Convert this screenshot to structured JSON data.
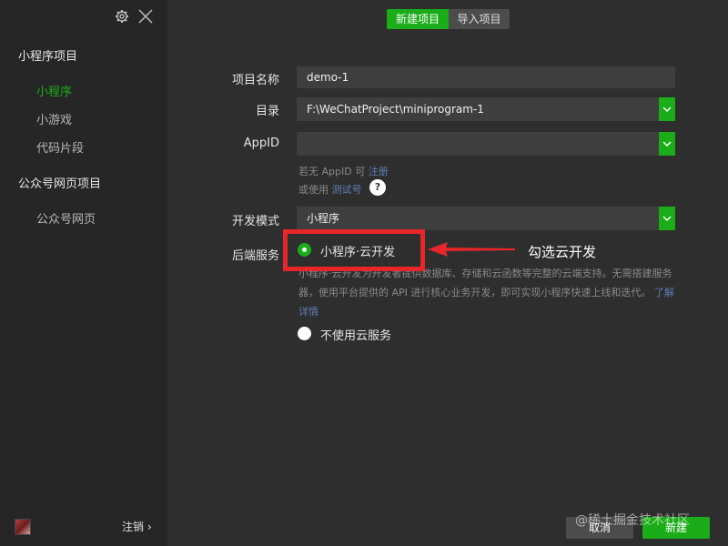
{
  "sidebar": {
    "groups": [
      {
        "title": "小程序项目",
        "items": [
          {
            "label": "小程序",
            "active": true
          },
          {
            "label": "小游戏",
            "active": false
          },
          {
            "label": "代码片段",
            "active": false
          }
        ]
      },
      {
        "title": "公众号网页项目",
        "items": [
          {
            "label": "公众号网页",
            "active": false
          }
        ]
      }
    ],
    "logout": "注销",
    "logout_chevron": "›"
  },
  "tabs": {
    "new": "新建项目",
    "import": "导入项目"
  },
  "form": {
    "name_label": "项目名称",
    "name_value": "demo-1",
    "dir_label": "目录",
    "dir_value": "F:\\WeChatProject\\miniprogram-1",
    "appid_label": "AppID",
    "appid_value": "",
    "appid_hint_prefix": "若无 AppID 可",
    "appid_hint_link": "注册",
    "test_hint_prefix": "或使用",
    "test_hint_link": "测试号",
    "help_glyph": "?",
    "mode_label": "开发模式",
    "mode_value": "小程序",
    "backend_label": "后端服务",
    "option_cloud": "小程序·云开发",
    "option_cloud_desc": "小程序·云开发为开发者提供数据库、存储和云函数等完整的云端支持。无需搭建服务器，使用平台提供的 API 进行核心业务开发，即可实现小程序快速上线和迭代。",
    "option_cloud_link": "了解详情",
    "option_none": "不使用云服务"
  },
  "annotation": {
    "text": "勾选云开发",
    "color": "#e8262a"
  },
  "buttons": {
    "cancel": "取消",
    "create": "新建"
  },
  "watermark": "@稀土掘金技术社区",
  "colors": {
    "accent": "#1aad19",
    "link": "#5d7fb8",
    "background": "#2e2e2e",
    "sidebar": "#262626"
  }
}
